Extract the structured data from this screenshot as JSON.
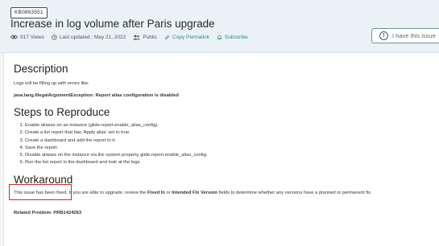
{
  "header": {
    "kb_number": "KB0863551",
    "title": "Increase in log volume after Paris upgrade",
    "views": "917 Views",
    "last_updated": "Last updated : May 21, 2022",
    "visibility": "Public",
    "copy_permalink": "Copy Permalink",
    "subscribe": "Subscribe",
    "have_issue_button": "I have this issue"
  },
  "article": {
    "description_heading": "Description",
    "description_text": "Logs will be filling up with errors like:",
    "error_text": "java.lang.IllegalArgumentException: Report alias configuration is disabled",
    "steps_heading": "Steps to Reproduce",
    "steps": [
      "Enable aliases on an instance (glide.report.enable_alias_config).",
      "Create a list report that has 'Apply alias' set to true.",
      "Create a dashboard and add the report to it.",
      "Save the report.",
      "Disable aliases on the instance via the system property glide.report.enable_alias_config.",
      "Run the list report in the dashboard and look at the logs."
    ],
    "workaround_heading": "Workaround",
    "workaround_fixed": "This issue has been fixed.",
    "workaround_text_1": " If you are able to upgrade, review the ",
    "workaround_fixed_in": "Fixed In",
    "workaround_text_2": " or ",
    "workaround_intended": "Intended Fix Version",
    "workaround_text_3": " fields to determine whether any versions have a planned or permanent fix.",
    "related_problem": "Related Problem: PRB1424263"
  },
  "colors": {
    "header_bg": "#eaf2f5",
    "link": "#2c8a7d",
    "highlight_border": "#e0202a"
  }
}
